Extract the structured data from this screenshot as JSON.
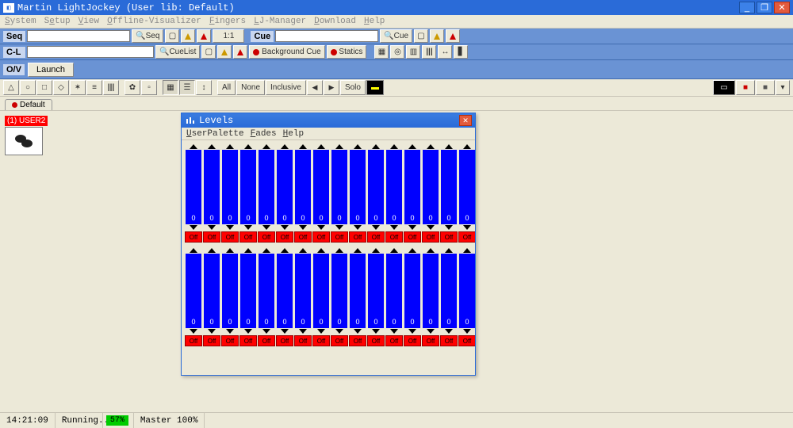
{
  "window": {
    "title": "Martin LightJockey (User lib: Default)"
  },
  "menus": [
    "System",
    "Setup",
    "View",
    "Offline-Visualizer",
    "Fingers",
    "LJ-Manager",
    "Download",
    "Help"
  ],
  "seq": {
    "label": "Seq",
    "btn": "Seq",
    "ratio": "1:1"
  },
  "cue": {
    "label_cue": "Cue",
    "btn_cue": "Cue"
  },
  "cl": {
    "label": "C-L",
    "btn": "CueList",
    "bg": "Background Cue",
    "statics": "Statics"
  },
  "ov": {
    "label": "O/V",
    "launch": "Launch"
  },
  "iconbar": {
    "all": "All",
    "none": "None",
    "incl": "Inclusive",
    "solo": "Solo"
  },
  "tabs": {
    "default": "Default"
  },
  "fixture": {
    "tag": "(1) USER2"
  },
  "levels": {
    "title": "Levels",
    "menus": [
      "UserPalette",
      "Fades",
      "Help"
    ],
    "channel_value": "0",
    "off_label": "Off",
    "channels_per_bank": 16,
    "banks": 2
  },
  "status": {
    "time": "14:21:09",
    "run": "Running..",
    "pct": "57%",
    "master": "Master 100%"
  }
}
